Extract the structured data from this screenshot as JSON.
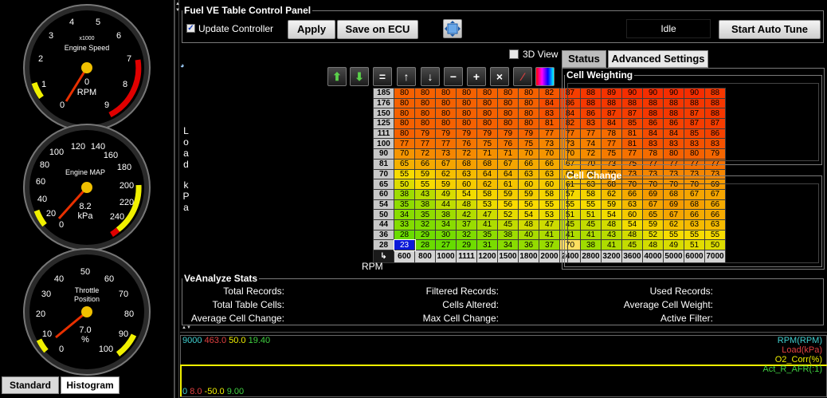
{
  "gauges": {
    "rpm": {
      "title": "Engine Speed",
      "unit_label": "RPM",
      "scale_note": "x1000",
      "value": "0",
      "ticks": [
        "0",
        "1",
        "2",
        "3",
        "4",
        "5",
        "6",
        "7",
        "8",
        "9"
      ]
    },
    "map": {
      "title": "Engine MAP",
      "unit_label": "kPa",
      "value": "8.2",
      "ticks": [
        "0",
        "20",
        "40",
        "60",
        "80",
        "100",
        "120",
        "140",
        "160",
        "180",
        "200",
        "220",
        "240"
      ]
    },
    "tps": {
      "title": "Throttle Position",
      "unit_label": "%",
      "value": "7.0",
      "ticks": [
        "0",
        "10",
        "20",
        "30",
        "40",
        "50",
        "60",
        "70",
        "80",
        "90",
        "100"
      ]
    }
  },
  "left_tabs": [
    "Standard",
    "Histogram"
  ],
  "panel": {
    "title": "Fuel VE Table Control Panel",
    "update_controller_label": "Update Controller",
    "update_controller_checked": true,
    "apply_label": "Apply",
    "save_label": "Save on ECU",
    "status_text": "Idle",
    "auto_tune_label": "Start Auto Tune",
    "view3d_label": "3D View"
  },
  "table": {
    "y_axis_label_top": "Load",
    "y_axis_label_bottom": "kPa",
    "x_axis_label": "RPM",
    "load_bins": [
      "185",
      "176",
      "150",
      "125",
      "111",
      "100",
      "90",
      "81",
      "70",
      "65",
      "60",
      "54",
      "50",
      "44",
      "36",
      "28"
    ],
    "rpm_bins": [
      "600",
      "800",
      "1000",
      "1111",
      "1200",
      "1500",
      "1800",
      "2000",
      "2400",
      "2800",
      "3200",
      "3600",
      "4000",
      "5000",
      "6000",
      "7000"
    ],
    "rows": [
      [
        "80",
        "80",
        "80",
        "80",
        "80",
        "80",
        "80",
        "82",
        "87",
        "88",
        "89",
        "90",
        "90",
        "90",
        "90",
        "88"
      ],
      [
        "80",
        "80",
        "80",
        "80",
        "80",
        "80",
        "80",
        "84",
        "86",
        "88",
        "88",
        "88",
        "88",
        "88",
        "88",
        "88"
      ],
      [
        "80",
        "80",
        "80",
        "80",
        "80",
        "80",
        "80",
        "83",
        "84",
        "86",
        "87",
        "87",
        "88",
        "88",
        "87",
        "88"
      ],
      [
        "80",
        "80",
        "80",
        "80",
        "80",
        "80",
        "80",
        "81",
        "82",
        "83",
        "84",
        "85",
        "86",
        "86",
        "87",
        "87"
      ],
      [
        "80",
        "79",
        "79",
        "79",
        "79",
        "79",
        "79",
        "77",
        "77",
        "77",
        "78",
        "81",
        "84",
        "84",
        "85",
        "86"
      ],
      [
        "77",
        "77",
        "77",
        "76",
        "75",
        "76",
        "75",
        "73",
        "73",
        "74",
        "77",
        "81",
        "83",
        "83",
        "83",
        "83"
      ],
      [
        "70",
        "72",
        "73",
        "72",
        "71",
        "71",
        "70",
        "70",
        "70",
        "72",
        "75",
        "77",
        "78",
        "80",
        "80",
        "79"
      ],
      [
        "65",
        "66",
        "67",
        "68",
        "68",
        "67",
        "66",
        "66",
        "67",
        "70",
        "73",
        "75",
        "77",
        "77",
        "77",
        "77"
      ],
      [
        "55",
        "59",
        "62",
        "63",
        "64",
        "64",
        "63",
        "63",
        "64",
        "66",
        "70",
        "73",
        "73",
        "73",
        "73",
        "73"
      ],
      [
        "50",
        "55",
        "59",
        "60",
        "62",
        "61",
        "60",
        "60",
        "61",
        "63",
        "68",
        "70",
        "70",
        "70",
        "70",
        "69"
      ],
      [
        "38",
        "43",
        "49",
        "54",
        "58",
        "59",
        "59",
        "58",
        "57",
        "58",
        "62",
        "66",
        "69",
        "68",
        "67",
        "67"
      ],
      [
        "35",
        "38",
        "44",
        "48",
        "53",
        "56",
        "56",
        "55",
        "55",
        "55",
        "59",
        "63",
        "67",
        "69",
        "68",
        "66"
      ],
      [
        "34",
        "35",
        "38",
        "42",
        "47",
        "52",
        "54",
        "53",
        "51",
        "51",
        "54",
        "60",
        "65",
        "67",
        "66",
        "66"
      ],
      [
        "33",
        "32",
        "34",
        "37",
        "41",
        "45",
        "48",
        "47",
        "45",
        "45",
        "48",
        "54",
        "59",
        "62",
        "63",
        "63"
      ],
      [
        "28",
        "29",
        "30",
        "32",
        "35",
        "38",
        "40",
        "41",
        "41",
        "41",
        "43",
        "48",
        "52",
        "55",
        "55",
        "55"
      ],
      [
        "23",
        "28",
        "27",
        "29",
        "31",
        "34",
        "36",
        "37",
        "70",
        "38",
        "41",
        "45",
        "48",
        "49",
        "51",
        "50"
      ]
    ]
  },
  "right_tabs": [
    "Status",
    "Advanced Settings"
  ],
  "right_groups": [
    "Cell Weighting",
    "Cell Change"
  ],
  "stats": {
    "title": "VeAnalyze Stats",
    "labels": [
      "Total Records:",
      "Filtered Records:",
      "Used Records:",
      "Total Table Cells:",
      "Cells Altered:",
      "Average Cell Weight:",
      "Average Cell Change:",
      "Max Cell Change:",
      "Active Filter:"
    ]
  },
  "graph": {
    "top_values": [
      "9000",
      "463.0",
      "50.0",
      "19.40"
    ],
    "bottom_values": [
      "0",
      "8.0",
      "-50.0",
      "9.00"
    ],
    "top_colors": [
      "#40d0d0",
      "#e04040",
      "#f0f000",
      "#40d040"
    ],
    "legend": [
      "RPM(RPM)",
      "Load(kPa)",
      "O2_Corr(%)",
      "Act_R_AFR(:1)"
    ]
  }
}
